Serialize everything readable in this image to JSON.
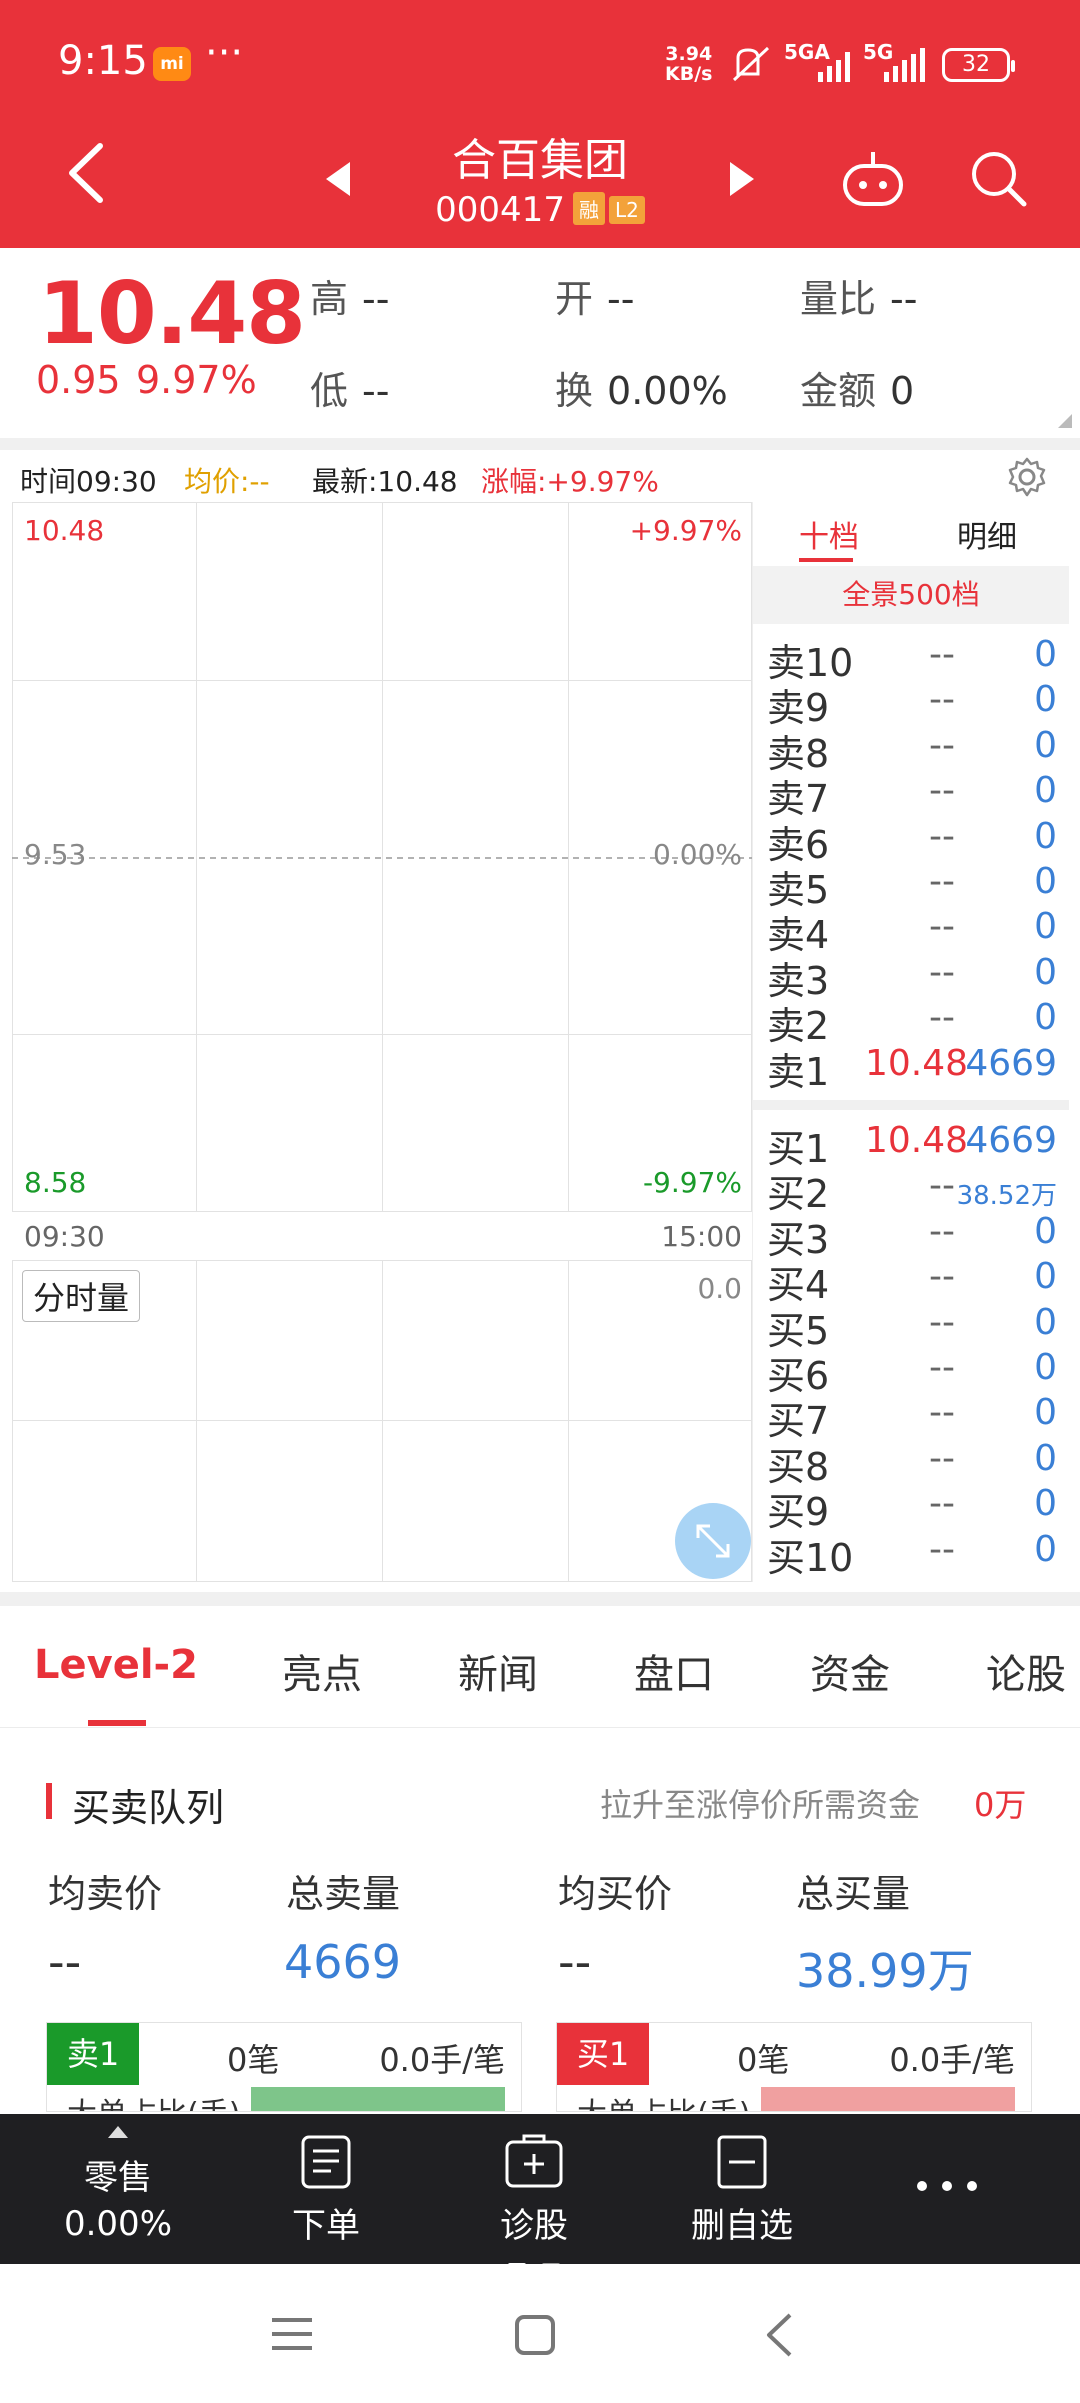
{
  "status_bar": {
    "time": "9:15",
    "mi_label": "mi",
    "dots": "···",
    "speed_top": "3.94",
    "speed_unit": "KB/s",
    "net1": "5GA",
    "net2": "5G",
    "battery": "32"
  },
  "header": {
    "stock_name": "合百集团",
    "stock_code": "000417",
    "badge_margin": "融",
    "badge_level": "L2"
  },
  "quote": {
    "price": "10.48",
    "change": "0.95",
    "change_pct": "9.97%",
    "high_label": "高",
    "high_value": "--",
    "open_label": "开",
    "open_value": "--",
    "vol_ratio_label": "量比",
    "vol_ratio_value": "--",
    "low_label": "低",
    "low_value": "--",
    "turnover_label": "换",
    "turnover_value": "0.00%",
    "amount_label": "金额",
    "amount_value": "0"
  },
  "chart_header": {
    "time": "时间09:30",
    "avg": "均价:--",
    "latest": "最新:10.48",
    "rise": "涨幅:+9.97%"
  },
  "chart": {
    "price_top": "10.48",
    "pct_top": "+9.97%",
    "price_mid": "9.53",
    "pct_mid": "0.00%",
    "price_bottom": "8.58",
    "pct_bottom": "-9.97%",
    "time_start": "09:30",
    "time_end": "15:00",
    "volume_label": "分时量",
    "volume_max": "0.0"
  },
  "order_book": {
    "tab_ten": "十档",
    "tab_detail": "明细",
    "full_depth": "全景500档",
    "sell": [
      {
        "label": "卖10",
        "price": "--",
        "volume": "0"
      },
      {
        "label": "卖9",
        "price": "--",
        "volume": "0"
      },
      {
        "label": "卖8",
        "price": "--",
        "volume": "0"
      },
      {
        "label": "卖7",
        "price": "--",
        "volume": "0"
      },
      {
        "label": "卖6",
        "price": "--",
        "volume": "0"
      },
      {
        "label": "卖5",
        "price": "--",
        "volume": "0"
      },
      {
        "label": "卖4",
        "price": "--",
        "volume": "0"
      },
      {
        "label": "卖3",
        "price": "--",
        "volume": "0"
      },
      {
        "label": "卖2",
        "price": "--",
        "volume": "0"
      },
      {
        "label": "卖1",
        "price": "10.48",
        "volume": "4669"
      }
    ],
    "buy": [
      {
        "label": "买1",
        "price": "10.48",
        "volume": "4669"
      },
      {
        "label": "买2",
        "price": "--",
        "volume": "38.52万"
      },
      {
        "label": "买3",
        "price": "--",
        "volume": "0"
      },
      {
        "label": "买4",
        "price": "--",
        "volume": "0"
      },
      {
        "label": "买5",
        "price": "--",
        "volume": "0"
      },
      {
        "label": "买6",
        "price": "--",
        "volume": "0"
      },
      {
        "label": "买7",
        "price": "--",
        "volume": "0"
      },
      {
        "label": "买8",
        "price": "--",
        "volume": "0"
      },
      {
        "label": "买9",
        "price": "--",
        "volume": "0"
      },
      {
        "label": "买10",
        "price": "--",
        "volume": "0"
      }
    ]
  },
  "tabs": [
    "Level-2",
    "亮点",
    "新闻",
    "盘口",
    "资金",
    "论股"
  ],
  "queue": {
    "title": "买卖队列",
    "hint": "拉升至涨停价所需资金",
    "hint_value": "0万",
    "avg_sell_label": "均卖价",
    "total_sell_label": "总卖量",
    "avg_buy_label": "均买价",
    "total_buy_label": "总买量",
    "avg_sell_value": "--",
    "total_sell_value": "4669",
    "avg_buy_value": "--",
    "total_buy_value": "38.99万",
    "sell_box": {
      "tag": "卖1",
      "count": "0笔",
      "per": "0.0手/笔",
      "ratio_label": "大单占比(手)"
    },
    "buy_box": {
      "tag": "买1",
      "count": "0笔",
      "per": "0.0手/笔",
      "ratio_label": "大单占比(手)"
    }
  },
  "actions": {
    "retail_label": "零售",
    "retail_value": "0.00%",
    "order": "下单",
    "diagnose": "诊股",
    "remove_fav": "删自选"
  },
  "colors": {
    "brand_red": "#e8323a",
    "down_green": "#1a9a2a",
    "buy_blue": "#3a7fd5",
    "avg_orange": "#e0a000"
  }
}
